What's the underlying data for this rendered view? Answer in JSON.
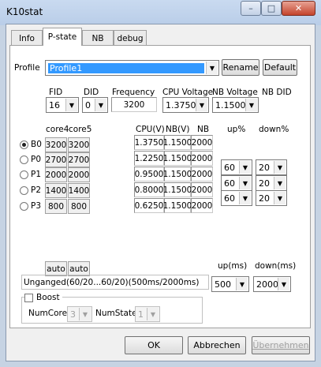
{
  "window": {
    "title": "K10stat",
    "min": "–",
    "max": "□",
    "close": "✕"
  },
  "tabs": [
    {
      "label": "Info"
    },
    {
      "label": "P-state"
    },
    {
      "label": "NB"
    },
    {
      "label": "debug"
    }
  ],
  "profile": {
    "label": "Profile",
    "value": "Profile1",
    "rename": "Rename",
    "default": "Default"
  },
  "headers": {
    "fid": "FID",
    "did": "DID",
    "frequency": "Frequency",
    "cpu_voltage": "CPU Voltage",
    "nb_voltage": "NB Voltage",
    "nb_did": "NB DID"
  },
  "settings": {
    "fid": "16",
    "did": "0",
    "frequency": "3200",
    "cpu_voltage": "1.3750",
    "nb_voltage": "1.1500"
  },
  "table": {
    "core4": "core4",
    "core5": "core5",
    "cpu_v": "CPU(V)",
    "nb_v": "NB(V)",
    "nb": "NB",
    "up": "up%",
    "down": "down%"
  },
  "pstates": [
    {
      "label": "B0",
      "c4": "3200",
      "c5": "3200",
      "cpu": "1.3750",
      "nbv": "1.1500",
      "nb": "2000",
      "selected": true
    },
    {
      "label": "P0",
      "c4": "2700",
      "c5": "2700",
      "cpu": "1.2250",
      "nbv": "1.1500",
      "nb": "2000"
    },
    {
      "label": "P1",
      "c4": "2000",
      "c5": "2000",
      "cpu": "0.9500",
      "nbv": "1.1500",
      "nb": "2000",
      "up": "60",
      "down": "20"
    },
    {
      "label": "P2",
      "c4": "1400",
      "c5": "1400",
      "cpu": "0.8000",
      "nbv": "1.1500",
      "nb": "2000",
      "up": "60",
      "down": "20"
    },
    {
      "label": "P3",
      "c4": "800",
      "c5": "800",
      "cpu": "0.6250",
      "nbv": "1.1500",
      "nb": "2000",
      "up": "60",
      "down": "20"
    }
  ],
  "auto": {
    "c4": "auto",
    "c5": "auto"
  },
  "timing": {
    "up_label": "up(ms)",
    "down_label": "down(ms)",
    "up": "500",
    "down": "2000",
    "status": "Unganged(60/20...60/20)(500ms/2000ms)"
  },
  "boost": {
    "label": "Boost",
    "numcore_label": "NumCore",
    "numcore": "3",
    "numstate_label": "NumState",
    "numstate": "1"
  },
  "buttons": {
    "ok": "OK",
    "cancel": "Abbrechen",
    "apply": "Übernehmen"
  }
}
